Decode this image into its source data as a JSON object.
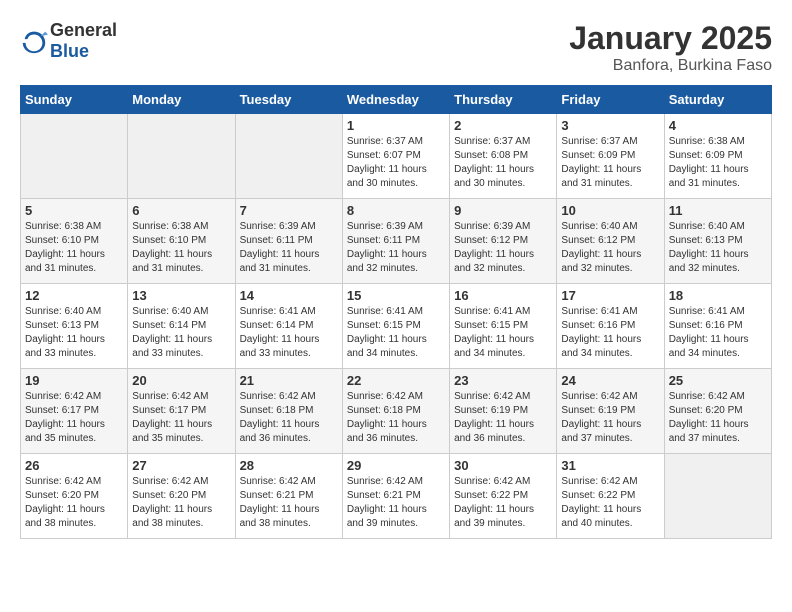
{
  "logo": {
    "general": "General",
    "blue": "Blue"
  },
  "title": "January 2025",
  "subtitle": "Banfora, Burkina Faso",
  "days_of_week": [
    "Sunday",
    "Monday",
    "Tuesday",
    "Wednesday",
    "Thursday",
    "Friday",
    "Saturday"
  ],
  "weeks": [
    [
      {
        "day": "",
        "info": ""
      },
      {
        "day": "",
        "info": ""
      },
      {
        "day": "",
        "info": ""
      },
      {
        "day": "1",
        "info": "Sunrise: 6:37 AM\nSunset: 6:07 PM\nDaylight: 11 hours\nand 30 minutes."
      },
      {
        "day": "2",
        "info": "Sunrise: 6:37 AM\nSunset: 6:08 PM\nDaylight: 11 hours\nand 30 minutes."
      },
      {
        "day": "3",
        "info": "Sunrise: 6:37 AM\nSunset: 6:09 PM\nDaylight: 11 hours\nand 31 minutes."
      },
      {
        "day": "4",
        "info": "Sunrise: 6:38 AM\nSunset: 6:09 PM\nDaylight: 11 hours\nand 31 minutes."
      }
    ],
    [
      {
        "day": "5",
        "info": "Sunrise: 6:38 AM\nSunset: 6:10 PM\nDaylight: 11 hours\nand 31 minutes."
      },
      {
        "day": "6",
        "info": "Sunrise: 6:38 AM\nSunset: 6:10 PM\nDaylight: 11 hours\nand 31 minutes."
      },
      {
        "day": "7",
        "info": "Sunrise: 6:39 AM\nSunset: 6:11 PM\nDaylight: 11 hours\nand 31 minutes."
      },
      {
        "day": "8",
        "info": "Sunrise: 6:39 AM\nSunset: 6:11 PM\nDaylight: 11 hours\nand 32 minutes."
      },
      {
        "day": "9",
        "info": "Sunrise: 6:39 AM\nSunset: 6:12 PM\nDaylight: 11 hours\nand 32 minutes."
      },
      {
        "day": "10",
        "info": "Sunrise: 6:40 AM\nSunset: 6:12 PM\nDaylight: 11 hours\nand 32 minutes."
      },
      {
        "day": "11",
        "info": "Sunrise: 6:40 AM\nSunset: 6:13 PM\nDaylight: 11 hours\nand 32 minutes."
      }
    ],
    [
      {
        "day": "12",
        "info": "Sunrise: 6:40 AM\nSunset: 6:13 PM\nDaylight: 11 hours\nand 33 minutes."
      },
      {
        "day": "13",
        "info": "Sunrise: 6:40 AM\nSunset: 6:14 PM\nDaylight: 11 hours\nand 33 minutes."
      },
      {
        "day": "14",
        "info": "Sunrise: 6:41 AM\nSunset: 6:14 PM\nDaylight: 11 hours\nand 33 minutes."
      },
      {
        "day": "15",
        "info": "Sunrise: 6:41 AM\nSunset: 6:15 PM\nDaylight: 11 hours\nand 34 minutes."
      },
      {
        "day": "16",
        "info": "Sunrise: 6:41 AM\nSunset: 6:15 PM\nDaylight: 11 hours\nand 34 minutes."
      },
      {
        "day": "17",
        "info": "Sunrise: 6:41 AM\nSunset: 6:16 PM\nDaylight: 11 hours\nand 34 minutes."
      },
      {
        "day": "18",
        "info": "Sunrise: 6:41 AM\nSunset: 6:16 PM\nDaylight: 11 hours\nand 34 minutes."
      }
    ],
    [
      {
        "day": "19",
        "info": "Sunrise: 6:42 AM\nSunset: 6:17 PM\nDaylight: 11 hours\nand 35 minutes."
      },
      {
        "day": "20",
        "info": "Sunrise: 6:42 AM\nSunset: 6:17 PM\nDaylight: 11 hours\nand 35 minutes."
      },
      {
        "day": "21",
        "info": "Sunrise: 6:42 AM\nSunset: 6:18 PM\nDaylight: 11 hours\nand 36 minutes."
      },
      {
        "day": "22",
        "info": "Sunrise: 6:42 AM\nSunset: 6:18 PM\nDaylight: 11 hours\nand 36 minutes."
      },
      {
        "day": "23",
        "info": "Sunrise: 6:42 AM\nSunset: 6:19 PM\nDaylight: 11 hours\nand 36 minutes."
      },
      {
        "day": "24",
        "info": "Sunrise: 6:42 AM\nSunset: 6:19 PM\nDaylight: 11 hours\nand 37 minutes."
      },
      {
        "day": "25",
        "info": "Sunrise: 6:42 AM\nSunset: 6:20 PM\nDaylight: 11 hours\nand 37 minutes."
      }
    ],
    [
      {
        "day": "26",
        "info": "Sunrise: 6:42 AM\nSunset: 6:20 PM\nDaylight: 11 hours\nand 38 minutes."
      },
      {
        "day": "27",
        "info": "Sunrise: 6:42 AM\nSunset: 6:20 PM\nDaylight: 11 hours\nand 38 minutes."
      },
      {
        "day": "28",
        "info": "Sunrise: 6:42 AM\nSunset: 6:21 PM\nDaylight: 11 hours\nand 38 minutes."
      },
      {
        "day": "29",
        "info": "Sunrise: 6:42 AM\nSunset: 6:21 PM\nDaylight: 11 hours\nand 39 minutes."
      },
      {
        "day": "30",
        "info": "Sunrise: 6:42 AM\nSunset: 6:22 PM\nDaylight: 11 hours\nand 39 minutes."
      },
      {
        "day": "31",
        "info": "Sunrise: 6:42 AM\nSunset: 6:22 PM\nDaylight: 11 hours\nand 40 minutes."
      },
      {
        "day": "",
        "info": ""
      }
    ]
  ],
  "colors": {
    "header_bg": "#1a5aa0",
    "header_text": "#ffffff",
    "border": "#cccccc",
    "odd_row": "#f9f9f9",
    "even_row": "#ffffff",
    "empty_cell": "#f0f0f0"
  }
}
